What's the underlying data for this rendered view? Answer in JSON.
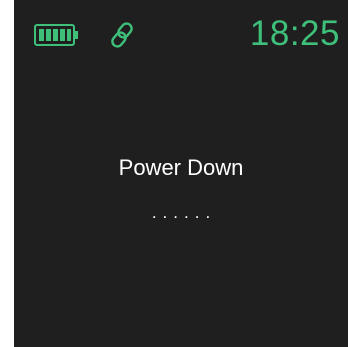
{
  "status_bar": {
    "battery_icon": "battery-full-icon",
    "link_icon": "link-icon",
    "time": "18:25"
  },
  "main": {
    "message": "Power Down",
    "progress_dots": "......"
  },
  "colors": {
    "background": "#1f1f1f",
    "accent": "#3ec07a",
    "text": "#ffffff"
  }
}
